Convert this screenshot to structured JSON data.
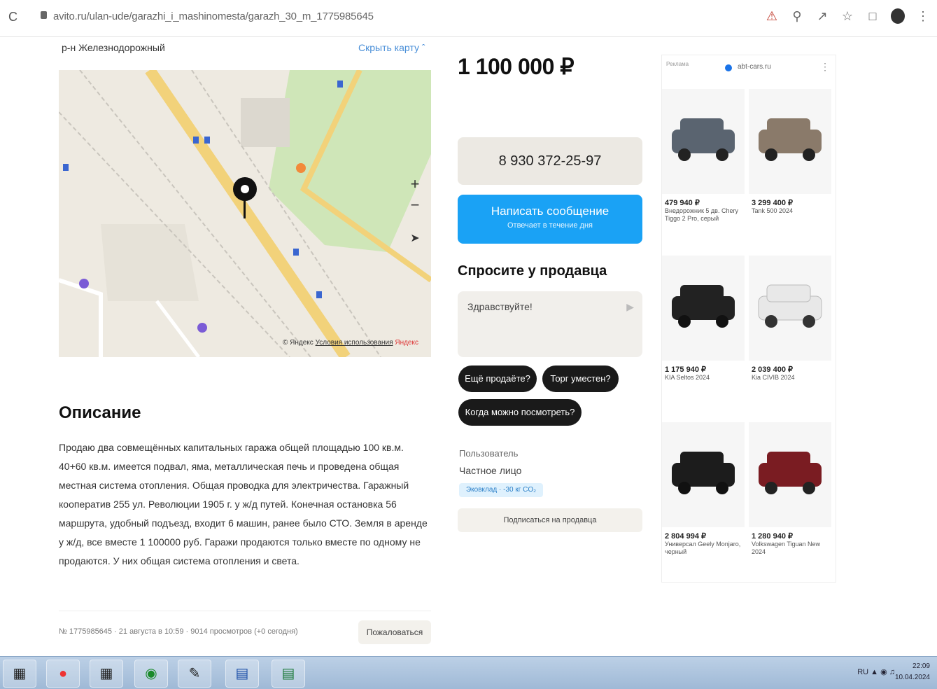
{
  "browser": {
    "url": "avito.ru/ulan-ude/garazhi_i_mashinomesta/garazh_30_m_1775985645"
  },
  "map": {
    "district": "р-н Железнодорожный",
    "hide_label": "Скрыть карту",
    "copyright": "© Яндекс",
    "terms": "Условия использования",
    "yandex": "Яндекс"
  },
  "description": {
    "title": "Описание",
    "text": "Продаю два совмещённых капитальных гаража общей площадью 100 кв.м. 40+60 кв.м. имеется подвал, яма, металлическая печь и проведена общая местная система отопления. Общая проводка для электричества. Гаражный кооператив 255 ул. Революции 1905 г. у ж/д путей. Конечная остановка 56 маршрута, удобный подъезд, входит 6 машин, ранее было СТО. Земля в аренде у ж/д, все вместе 1 100000 руб. Гаражи продаются только вместе по одному не продаются. У них общая система отопления и света."
  },
  "listing_meta": {
    "info": "№ 1775985645 · 21 августа в 10:59 · 9014 просмотров (+0 сегодня)",
    "complain": "Пожаловаться"
  },
  "offer": {
    "price": "1 100 000 ₽",
    "phone": "8 930 372-25-97",
    "message_label": "Написать сообщение",
    "message_sub": "Отвечает в течение дня"
  },
  "ask": {
    "title": "Спросите у продавца",
    "placeholder": "Здравствуйте!",
    "chips": [
      "Ещё продаёте?",
      "Торг уместен?",
      "Когда можно посмотреть?"
    ]
  },
  "seller": {
    "role": "Пользователь",
    "name": "Частное лицо",
    "eco": "Эковклад · -30 кг CO₂",
    "subscribe": "Подписаться на продавца"
  },
  "ad": {
    "tag": "Реклама",
    "domain": "abt-cars.ru",
    "cars": [
      {
        "price": "479 940 ₽",
        "name": "Внедорожник 5 дв. Chery Tiggo 2 Pro, серый",
        "color": "#5a6470"
      },
      {
        "price": "3 299 400 ₽",
        "name": "Tank 500 2024",
        "color": "#8a7a6a"
      },
      {
        "price": "1 175 940 ₽",
        "name": "KIA Seltos 2024",
        "color": "#222222"
      },
      {
        "price": "2 039 400 ₽",
        "name": "Kia CIVIB 2024",
        "color": "#e8e8e8"
      },
      {
        "price": "2 804 994 ₽",
        "name": "Универсал Geely Monjaro, черный",
        "color": "#1c1c1c"
      },
      {
        "price": "1 280 940 ₽",
        "name": "Volkswagen Tiguan New 2024",
        "color": "#7a1c22"
      }
    ]
  },
  "taskbar": {
    "lang": "RU",
    "time": "22:09",
    "date": "10.04.2024"
  },
  "colors": {
    "accent_blue": "#1aa2f5",
    "chip_dark": "#1a1a1a"
  }
}
